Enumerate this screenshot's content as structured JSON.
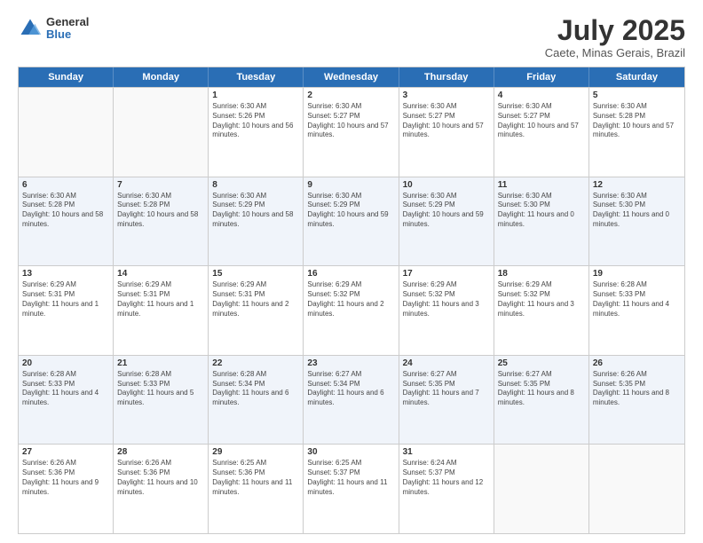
{
  "header": {
    "logo": {
      "general": "General",
      "blue": "Blue"
    },
    "title": "July 2025",
    "location": "Caete, Minas Gerais, Brazil"
  },
  "weekdays": [
    "Sunday",
    "Monday",
    "Tuesday",
    "Wednesday",
    "Thursday",
    "Friday",
    "Saturday"
  ],
  "rows": [
    [
      {
        "day": "",
        "info": "",
        "empty": true
      },
      {
        "day": "",
        "info": "",
        "empty": true
      },
      {
        "day": "1",
        "info": "Sunrise: 6:30 AM\nSunset: 5:26 PM\nDaylight: 10 hours and 56 minutes."
      },
      {
        "day": "2",
        "info": "Sunrise: 6:30 AM\nSunset: 5:27 PM\nDaylight: 10 hours and 57 minutes."
      },
      {
        "day": "3",
        "info": "Sunrise: 6:30 AM\nSunset: 5:27 PM\nDaylight: 10 hours and 57 minutes."
      },
      {
        "day": "4",
        "info": "Sunrise: 6:30 AM\nSunset: 5:27 PM\nDaylight: 10 hours and 57 minutes."
      },
      {
        "day": "5",
        "info": "Sunrise: 6:30 AM\nSunset: 5:28 PM\nDaylight: 10 hours and 57 minutes."
      }
    ],
    [
      {
        "day": "6",
        "info": "Sunrise: 6:30 AM\nSunset: 5:28 PM\nDaylight: 10 hours and 58 minutes."
      },
      {
        "day": "7",
        "info": "Sunrise: 6:30 AM\nSunset: 5:28 PM\nDaylight: 10 hours and 58 minutes."
      },
      {
        "day": "8",
        "info": "Sunrise: 6:30 AM\nSunset: 5:29 PM\nDaylight: 10 hours and 58 minutes."
      },
      {
        "day": "9",
        "info": "Sunrise: 6:30 AM\nSunset: 5:29 PM\nDaylight: 10 hours and 59 minutes."
      },
      {
        "day": "10",
        "info": "Sunrise: 6:30 AM\nSunset: 5:29 PM\nDaylight: 10 hours and 59 minutes."
      },
      {
        "day": "11",
        "info": "Sunrise: 6:30 AM\nSunset: 5:30 PM\nDaylight: 11 hours and 0 minutes."
      },
      {
        "day": "12",
        "info": "Sunrise: 6:30 AM\nSunset: 5:30 PM\nDaylight: 11 hours and 0 minutes."
      }
    ],
    [
      {
        "day": "13",
        "info": "Sunrise: 6:29 AM\nSunset: 5:31 PM\nDaylight: 11 hours and 1 minute."
      },
      {
        "day": "14",
        "info": "Sunrise: 6:29 AM\nSunset: 5:31 PM\nDaylight: 11 hours and 1 minute."
      },
      {
        "day": "15",
        "info": "Sunrise: 6:29 AM\nSunset: 5:31 PM\nDaylight: 11 hours and 2 minutes."
      },
      {
        "day": "16",
        "info": "Sunrise: 6:29 AM\nSunset: 5:32 PM\nDaylight: 11 hours and 2 minutes."
      },
      {
        "day": "17",
        "info": "Sunrise: 6:29 AM\nSunset: 5:32 PM\nDaylight: 11 hours and 3 minutes."
      },
      {
        "day": "18",
        "info": "Sunrise: 6:29 AM\nSunset: 5:32 PM\nDaylight: 11 hours and 3 minutes."
      },
      {
        "day": "19",
        "info": "Sunrise: 6:28 AM\nSunset: 5:33 PM\nDaylight: 11 hours and 4 minutes."
      }
    ],
    [
      {
        "day": "20",
        "info": "Sunrise: 6:28 AM\nSunset: 5:33 PM\nDaylight: 11 hours and 4 minutes."
      },
      {
        "day": "21",
        "info": "Sunrise: 6:28 AM\nSunset: 5:33 PM\nDaylight: 11 hours and 5 minutes."
      },
      {
        "day": "22",
        "info": "Sunrise: 6:28 AM\nSunset: 5:34 PM\nDaylight: 11 hours and 6 minutes."
      },
      {
        "day": "23",
        "info": "Sunrise: 6:27 AM\nSunset: 5:34 PM\nDaylight: 11 hours and 6 minutes."
      },
      {
        "day": "24",
        "info": "Sunrise: 6:27 AM\nSunset: 5:35 PM\nDaylight: 11 hours and 7 minutes."
      },
      {
        "day": "25",
        "info": "Sunrise: 6:27 AM\nSunset: 5:35 PM\nDaylight: 11 hours and 8 minutes."
      },
      {
        "day": "26",
        "info": "Sunrise: 6:26 AM\nSunset: 5:35 PM\nDaylight: 11 hours and 8 minutes."
      }
    ],
    [
      {
        "day": "27",
        "info": "Sunrise: 6:26 AM\nSunset: 5:36 PM\nDaylight: 11 hours and 9 minutes."
      },
      {
        "day": "28",
        "info": "Sunrise: 6:26 AM\nSunset: 5:36 PM\nDaylight: 11 hours and 10 minutes."
      },
      {
        "day": "29",
        "info": "Sunrise: 6:25 AM\nSunset: 5:36 PM\nDaylight: 11 hours and 11 minutes."
      },
      {
        "day": "30",
        "info": "Sunrise: 6:25 AM\nSunset: 5:37 PM\nDaylight: 11 hours and 11 minutes."
      },
      {
        "day": "31",
        "info": "Sunrise: 6:24 AM\nSunset: 5:37 PM\nDaylight: 11 hours and 12 minutes."
      },
      {
        "day": "",
        "info": "",
        "empty": true
      },
      {
        "day": "",
        "info": "",
        "empty": true
      }
    ]
  ]
}
